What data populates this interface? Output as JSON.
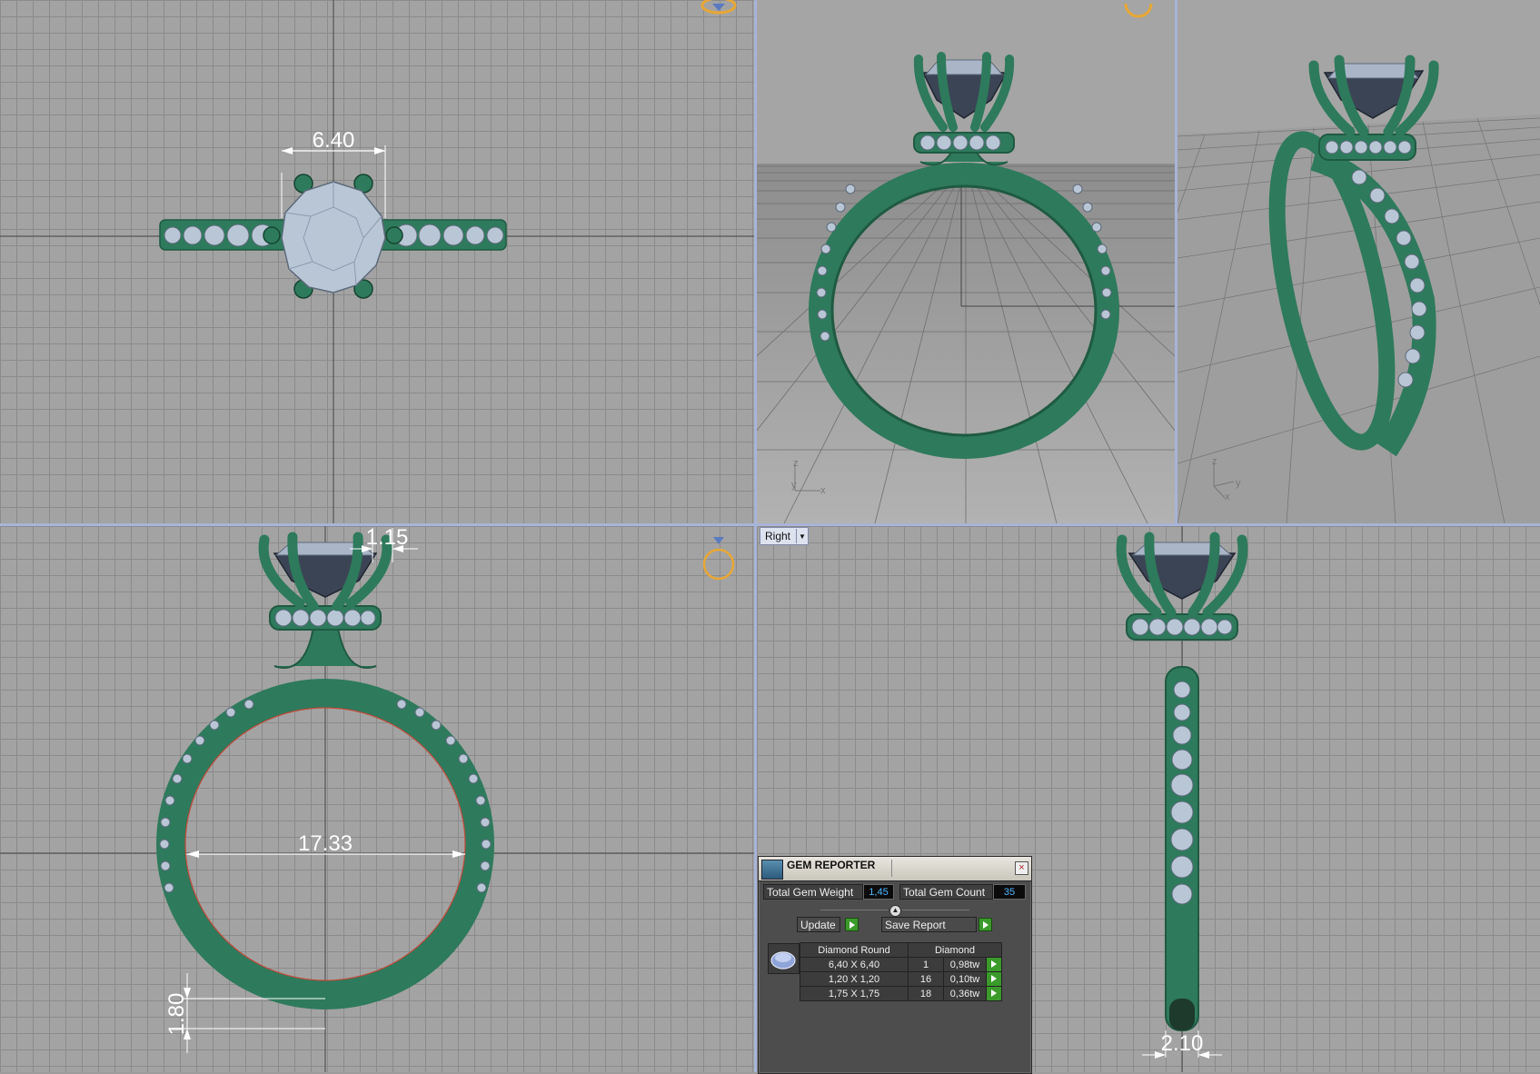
{
  "viewports": {
    "top_dimension": "6.40",
    "front_dimensions": {
      "prong": "1.15",
      "inner_diameter": "17.33",
      "band": "1.80"
    },
    "right_dimension": "2.10",
    "right_view_selector": "Right",
    "axis_labels": {
      "z": "z",
      "y": "y",
      "x": "x"
    }
  },
  "gem_reporter": {
    "title": "GEM REPORTER",
    "close_glyph": "×",
    "total_weight_label": "Total Gem Weight",
    "total_weight_value": "1,45",
    "total_count_label": "Total Gem Count",
    "total_count_value": "35",
    "update_label": "Update",
    "save_report_label": "Save Report",
    "table": {
      "headers": [
        "Diamond Round",
        "Diamond"
      ],
      "rows": [
        {
          "size": "6,40 X 6,40",
          "count": "1",
          "weight": "0,98tw"
        },
        {
          "size": "1,20 X 1,20",
          "count": "16",
          "weight": "0,10tw"
        },
        {
          "size": "1,75 X 1,75",
          "count": "18",
          "weight": "0,36tw"
        }
      ]
    }
  },
  "colors": {
    "ring_metal": "#2e7a5c",
    "gem": "#b9c6d6",
    "dimension": "#ffffff",
    "separator": "#a8b4d8"
  }
}
